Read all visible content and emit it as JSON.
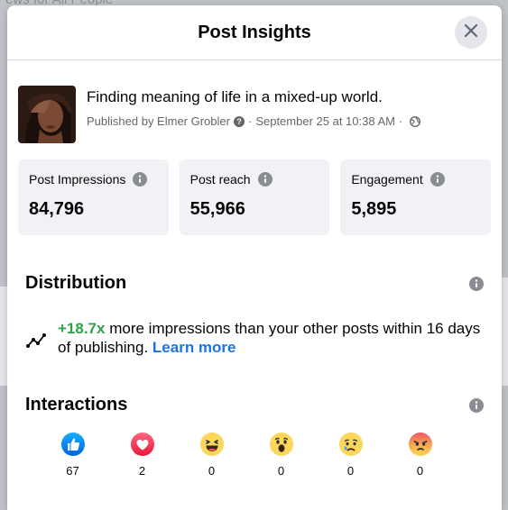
{
  "backdrop": {
    "text": "ews for All People"
  },
  "modal": {
    "title": "Post Insights"
  },
  "post": {
    "text": "Finding meaning of life in a mixed-up world.",
    "published_prefix": "Published by Elmer Grobler",
    "separator": "·",
    "date": "September 25 at 10:38 AM",
    "separator2": "·"
  },
  "stats": [
    {
      "label": "Post Impressions",
      "value": "84,796"
    },
    {
      "label": "Post reach",
      "value": "55,966"
    },
    {
      "label": "Engagement",
      "value": "5,895"
    }
  ],
  "distribution": {
    "title": "Distribution",
    "delta": "+18.7x",
    "text": " more impressions than your other posts within 16 days of publishing. ",
    "learn_more": "Learn more"
  },
  "interactions": {
    "title": "Interactions",
    "reactions": [
      {
        "icon": "like-icon",
        "count": "67"
      },
      {
        "icon": "love-icon",
        "count": "2"
      },
      {
        "icon": "haha-icon",
        "count": "0"
      },
      {
        "icon": "wow-icon",
        "count": "0"
      },
      {
        "icon": "sad-icon",
        "count": "0"
      },
      {
        "icon": "angry-icon",
        "count": "0"
      }
    ]
  },
  "colors": {
    "accent": "#1b74e4",
    "positive": "#31a24c",
    "secondary_text": "#65676b",
    "card_bg": "#f0f2f5"
  }
}
